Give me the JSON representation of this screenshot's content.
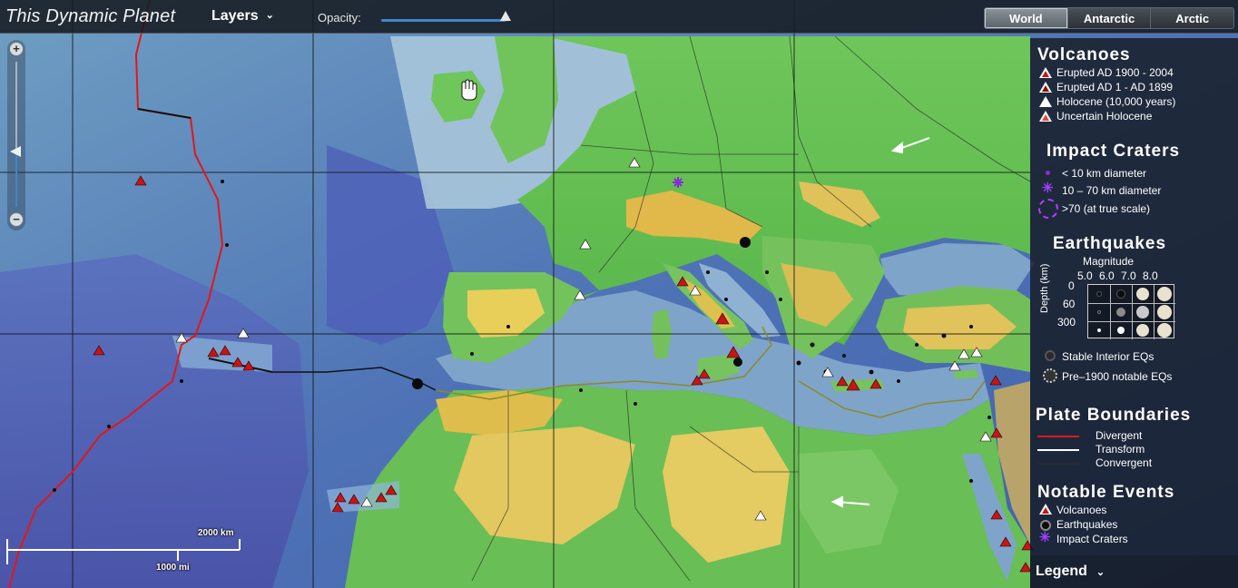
{
  "app": {
    "title": "This Dynamic Planet"
  },
  "toolbar": {
    "layers_label": "Layers",
    "opacity_label": "Opacity:",
    "opacity_value": 0.98,
    "view_tabs": [
      {
        "label": "World",
        "active": true
      },
      {
        "label": "Antarctic",
        "active": false
      },
      {
        "label": "Arctic",
        "active": false
      }
    ]
  },
  "zoom": {
    "level_fraction": 0.38
  },
  "scalebar": {
    "km_label": "2000 km",
    "mi_label": "1000 mi"
  },
  "legend": {
    "volcanoes": {
      "title": "Volcanoes",
      "items": [
        {
          "label": "Erupted AD 1900 - 2004",
          "fill": "#c81414"
        },
        {
          "label": "Erupted AD 1 - AD 1899",
          "fill": "#8a1010"
        },
        {
          "label": "Holocene (10,000 years)",
          "fill": "#ffffff"
        },
        {
          "label": "Uncertain Holocene",
          "fill": "#e04a3a"
        }
      ]
    },
    "impact_craters": {
      "title": "Impact Craters",
      "items": [
        {
          "label": "< 10 km diameter"
        },
        {
          "label": "10 – 70 km diameter"
        },
        {
          "label": ">70 (at true scale)"
        }
      ]
    },
    "earthquakes": {
      "title": "Earthquakes",
      "magnitude_label": "Magnitude",
      "magnitudes": [
        "5.0",
        "6.0",
        "7.0",
        "8.0"
      ],
      "depth_label": "Depth (km)",
      "depths": [
        "0",
        "60",
        "300"
      ],
      "stable_label": "Stable Interior EQs",
      "pre1900_label": "Pre–1900 notable EQs"
    },
    "plate_boundaries": {
      "title": "Plate Boundaries",
      "items": [
        {
          "label": "Divergent",
          "color": "#e01818"
        },
        {
          "label": "Transform",
          "color": "#ffffff"
        },
        {
          "label": "Convergent",
          "color": "#2a2a2a"
        }
      ]
    },
    "notable_events": {
      "title": "Notable Events",
      "items": [
        {
          "label": "Volcanoes"
        },
        {
          "label": "Earthquakes"
        },
        {
          "label": "Impact Craters"
        }
      ]
    },
    "toggle_label": "Legend"
  }
}
